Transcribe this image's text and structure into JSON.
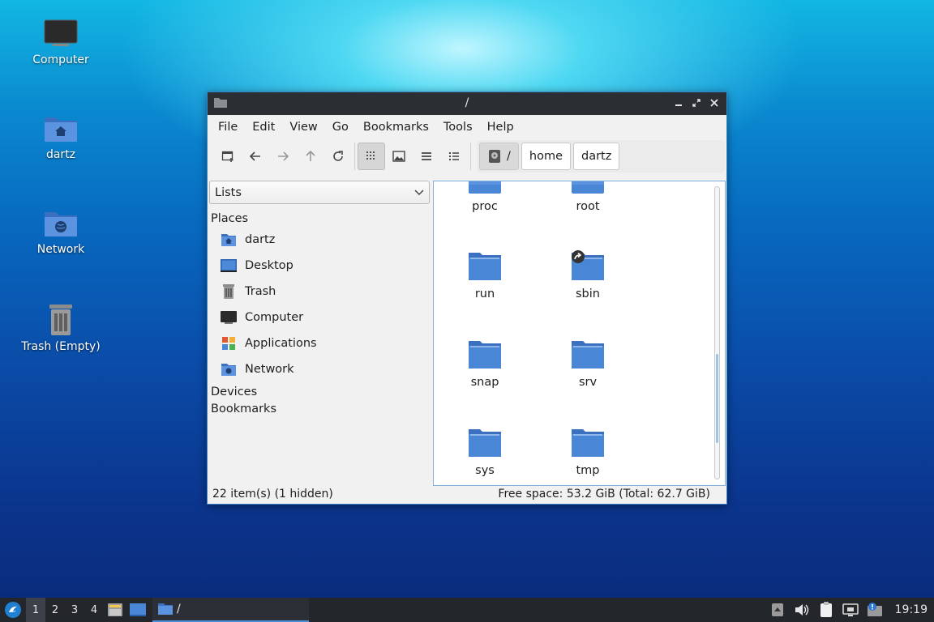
{
  "desktop": {
    "icons": [
      {
        "label": "Computer"
      },
      {
        "label": "dartz"
      },
      {
        "label": "Network"
      },
      {
        "label": "Trash (Empty)"
      }
    ]
  },
  "window": {
    "title": "/",
    "menu": [
      "File",
      "Edit",
      "View",
      "Go",
      "Bookmarks",
      "Tools",
      "Help"
    ],
    "pathbar": {
      "root": "/",
      "crumbs": [
        "home",
        "dartz"
      ]
    },
    "sidebar": {
      "combo_value": "Lists",
      "places_heading": "Places",
      "places": [
        "dartz",
        "Desktop",
        "Trash",
        "Computer",
        "Applications",
        "Network"
      ],
      "devices_heading": "Devices",
      "bookmarks_heading": "Bookmarks"
    },
    "files": [
      "proc",
      "root",
      "run",
      "sbin",
      "snap",
      "srv",
      "sys",
      "tmp"
    ],
    "status": {
      "items": "22 item(s) (1 hidden)",
      "free_space": "Free space: 53.2 GiB (Total: 62.7 GiB)"
    },
    "accent_color": "#4a86d6"
  },
  "taskbar": {
    "workspaces": [
      "1",
      "2",
      "3",
      "4"
    ],
    "active_workspace": "1",
    "task_title": "/",
    "clock": "19:19"
  }
}
